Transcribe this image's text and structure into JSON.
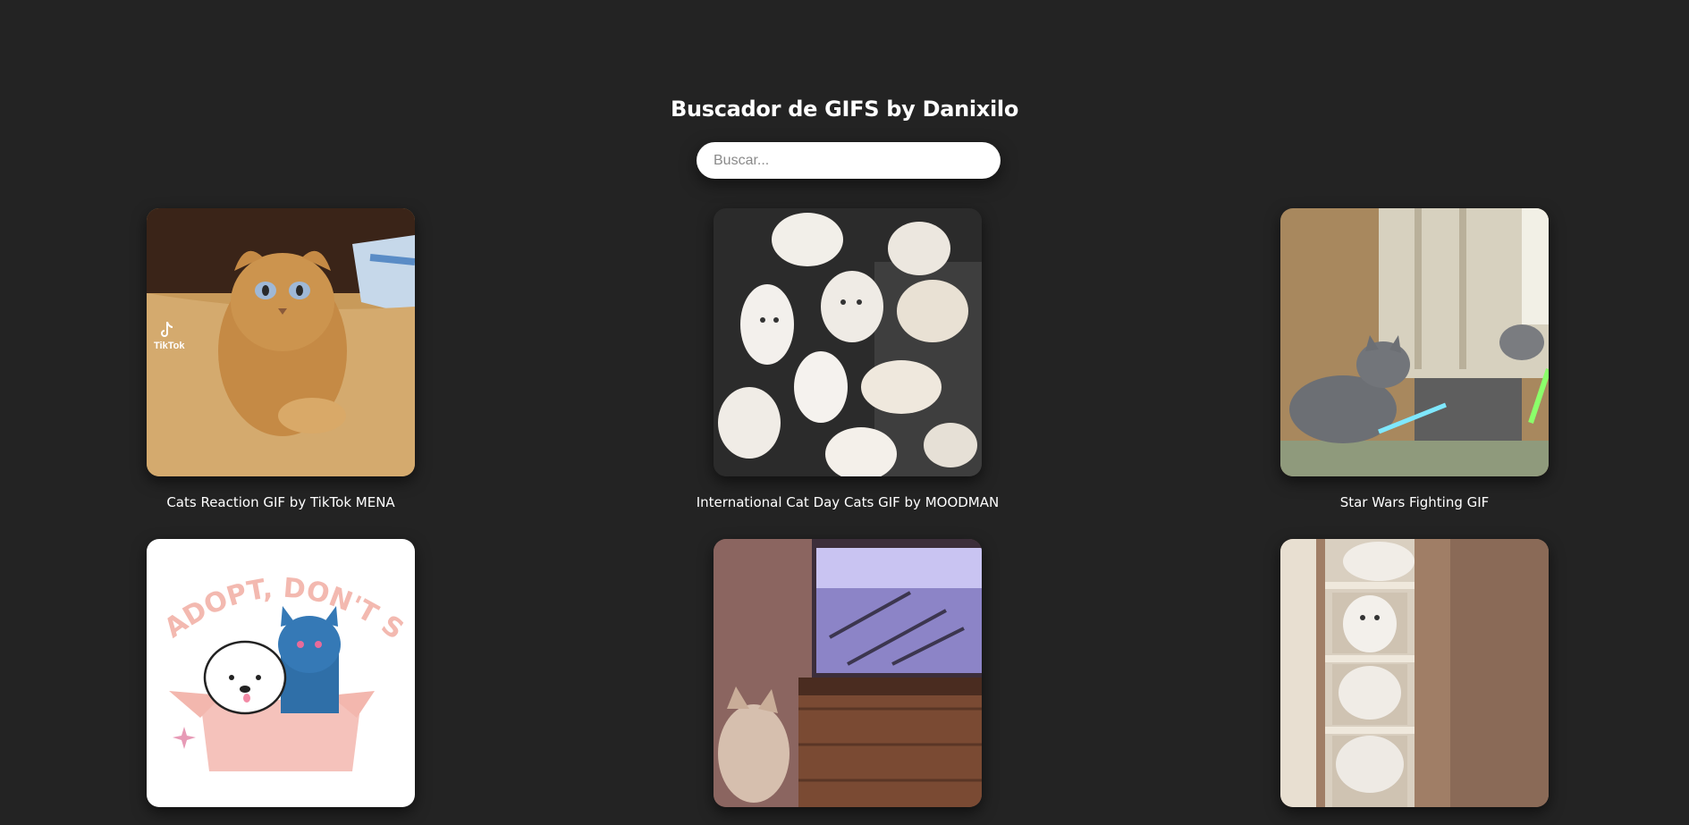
{
  "header": {
    "title": "Buscador de GIFS by Danixilo"
  },
  "search": {
    "placeholder": "Buscar...",
    "value": ""
  },
  "gifs": [
    {
      "title": "Cats Reaction GIF by TikTok MENA",
      "overlay_text": "TikTok"
    },
    {
      "title": "International Cat Day Cats GIF by MOODMAN"
    },
    {
      "title": "Star Wars Fighting GIF"
    },
    {
      "title": "",
      "overlay_text": "ADOPT, DON'T SHOP"
    },
    {
      "title": ""
    },
    {
      "title": ""
    }
  ]
}
